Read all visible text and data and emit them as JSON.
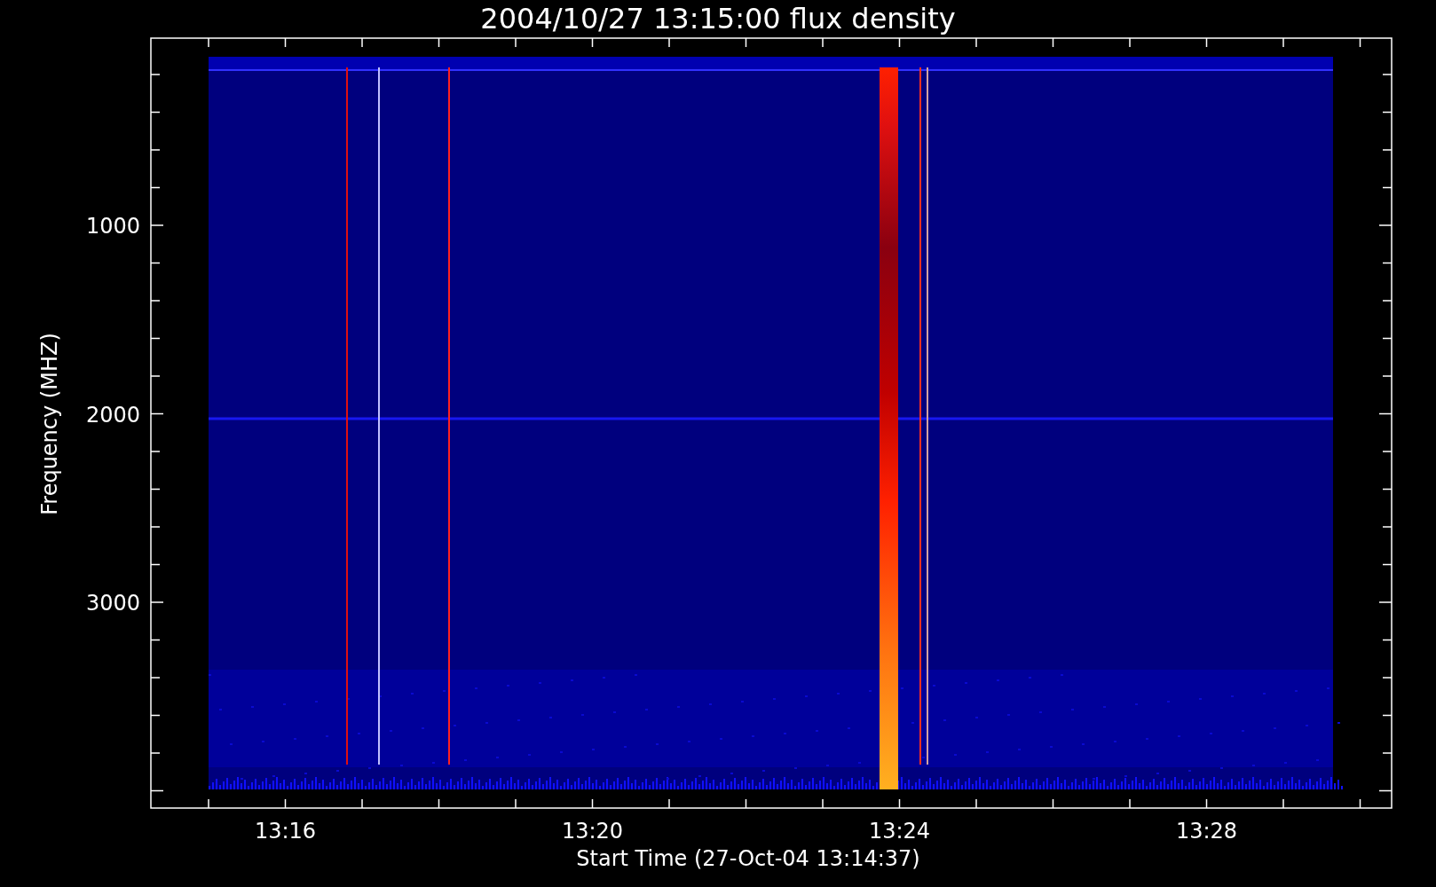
{
  "title": "2004/10/27 13:15:00 flux density",
  "y_axis": {
    "label": "Frequency (MHZ)",
    "tick_labels": [
      "1000",
      "2000",
      "3000"
    ]
  },
  "x_axis": {
    "label": "Start Time (27-Oct-04 13:14:37)",
    "tick_labels": [
      "13:16",
      "13:20",
      "13:24",
      "13:28"
    ]
  }
}
